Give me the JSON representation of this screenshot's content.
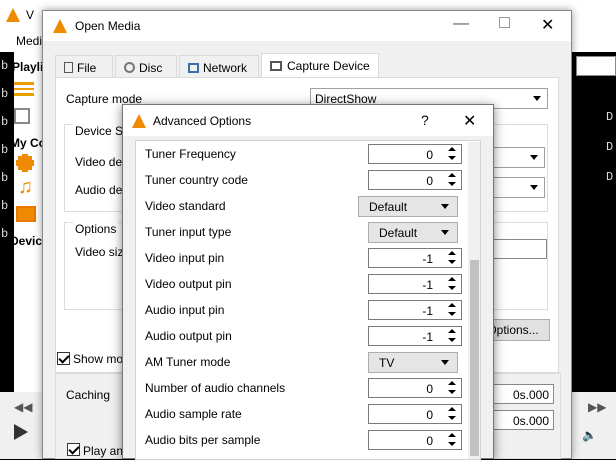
{
  "background": {
    "title_fragment": "V",
    "menu_fragment": "Medi",
    "sidebar": {
      "playlist": "Playlis",
      "my_computer": "My Co",
      "devices": "Device"
    },
    "console_chars": [
      "b",
      "b",
      "b",
      "b",
      "b",
      "b",
      "b"
    ],
    "right_chars": [
      "D",
      "D",
      "D"
    ]
  },
  "open_media": {
    "title": "Open Media",
    "tabs": [
      {
        "label": "File",
        "icon": "file-icon"
      },
      {
        "label": "Disc",
        "icon": "disc-icon"
      },
      {
        "label": "Network",
        "icon": "network-icon"
      },
      {
        "label": "Capture Device",
        "icon": "capture-device-icon"
      }
    ],
    "capture_mode_label": "Capture mode",
    "capture_mode_value": "DirectShow",
    "device_selection_label": "Device Se",
    "video_device_label": "Video dev",
    "audio_device_label": "Audio dev",
    "options_label": "Options",
    "video_size_label": "Video size",
    "advanced_button": "Options...",
    "show_more_label": "Show more",
    "caching_label": "Caching",
    "caching_value": "0s.000",
    "start_time_value": "0s.000",
    "play_label": "Play and"
  },
  "advanced": {
    "title": "Advanced Options",
    "help": "?",
    "close": "✕",
    "rows": [
      {
        "label": "Tuner Frequency",
        "kind": "spin",
        "value": "0"
      },
      {
        "label": "Tuner country code",
        "kind": "spin",
        "value": "0"
      },
      {
        "label": "Video standard",
        "kind": "dropdown",
        "value": "Default"
      },
      {
        "label": "Tuner input type",
        "kind": "dropdown",
        "value": "Default"
      },
      {
        "label": "Video input pin",
        "kind": "spin",
        "value": "-1"
      },
      {
        "label": "Video output pin",
        "kind": "spin",
        "value": "-1"
      },
      {
        "label": "Audio input pin",
        "kind": "spin",
        "value": "-1"
      },
      {
        "label": "Audio output pin",
        "kind": "spin",
        "value": "-1"
      },
      {
        "label": "AM Tuner mode",
        "kind": "dropdown",
        "value": "TV"
      },
      {
        "label": "Number of audio channels",
        "kind": "spin",
        "value": "0"
      },
      {
        "label": "Audio sample rate",
        "kind": "spin",
        "value": "0"
      },
      {
        "label": "Audio bits per sample",
        "kind": "spin",
        "value": "0"
      }
    ]
  }
}
